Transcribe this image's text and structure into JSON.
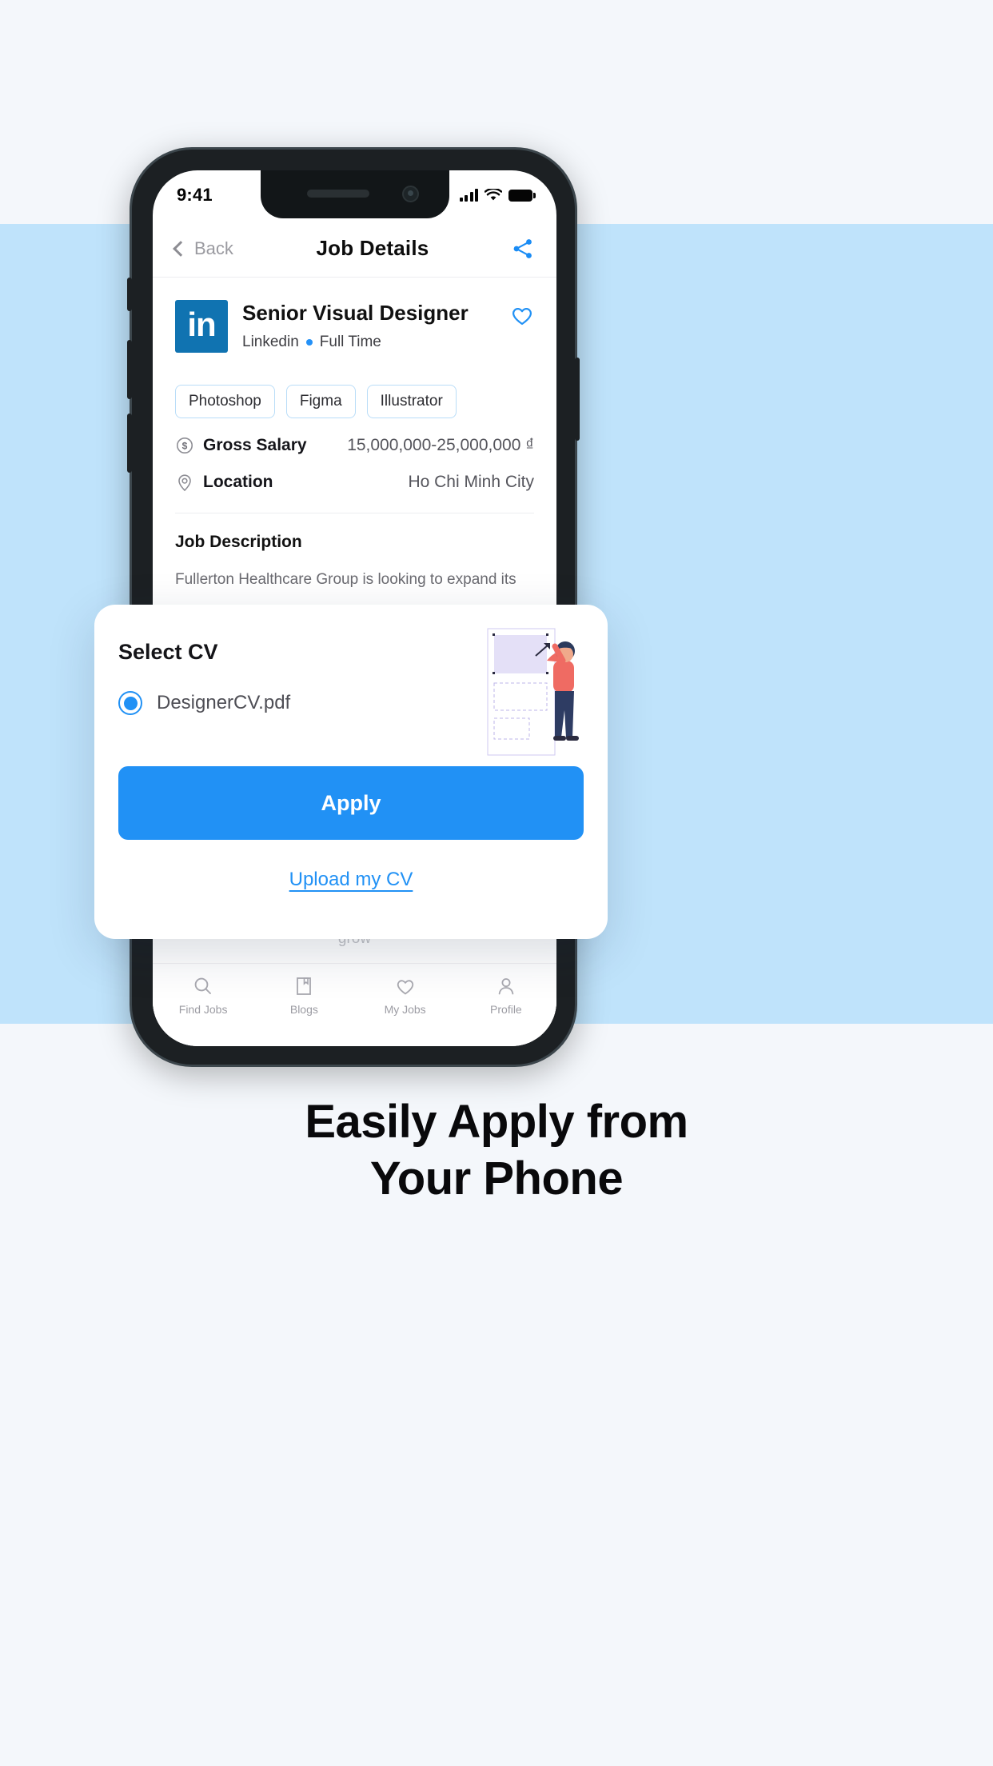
{
  "phone": {
    "status": {
      "time": "9:41",
      "signal_icon": "signal-bars-icon",
      "wifi_icon": "wifi-icon",
      "battery_icon": "battery-icon"
    },
    "appbar": {
      "back_label": "Back",
      "title": "Job Details",
      "share_icon": "share-icon"
    },
    "job": {
      "company_logo_text": "in",
      "company_logo_color": "#1073b1",
      "title": "Senior Visual Designer",
      "company": "Linkedin",
      "employment_type": "Full Time",
      "favorite_icon": "heart-icon",
      "tags": [
        "Photoshop",
        "Figma",
        "Illustrator"
      ],
      "details": [
        {
          "icon": "dollar-circle-icon",
          "label": "Gross Salary",
          "value": "15,000,000-25,000,000 ₫"
        },
        {
          "icon": "location-pin-icon",
          "label": "Location",
          "value": "Ho Chi Minh City"
        }
      ],
      "description_heading": "Job Description",
      "description_line1": "Fullerton Healthcare Group is looking to expand its",
      "description_tail": "features that address our clients’ needs and help us grow"
    },
    "tabbar": [
      {
        "icon": "search-icon",
        "label": "Find Jobs"
      },
      {
        "icon": "bookmark-icon",
        "label": "Blogs"
      },
      {
        "icon": "heart-icon",
        "label": "My Jobs"
      },
      {
        "icon": "person-icon",
        "label": "Profile"
      }
    ]
  },
  "modal": {
    "title": "Select CV",
    "cv_options": [
      {
        "name": "DesignerCV.pdf",
        "selected": true
      }
    ],
    "apply_label": "Apply",
    "upload_label": "Upload my CV",
    "illustration_icon": "person-designing-illustration",
    "accent_color": "#2191f5"
  },
  "headline": {
    "line1": "Easily Apply from",
    "line2": "Your Phone",
    "underline_color": "#2191f5"
  },
  "theme": {
    "page_bg": "#f4f7fb",
    "band_bg": "#bfe3fb",
    "accent": "#2191f5"
  }
}
